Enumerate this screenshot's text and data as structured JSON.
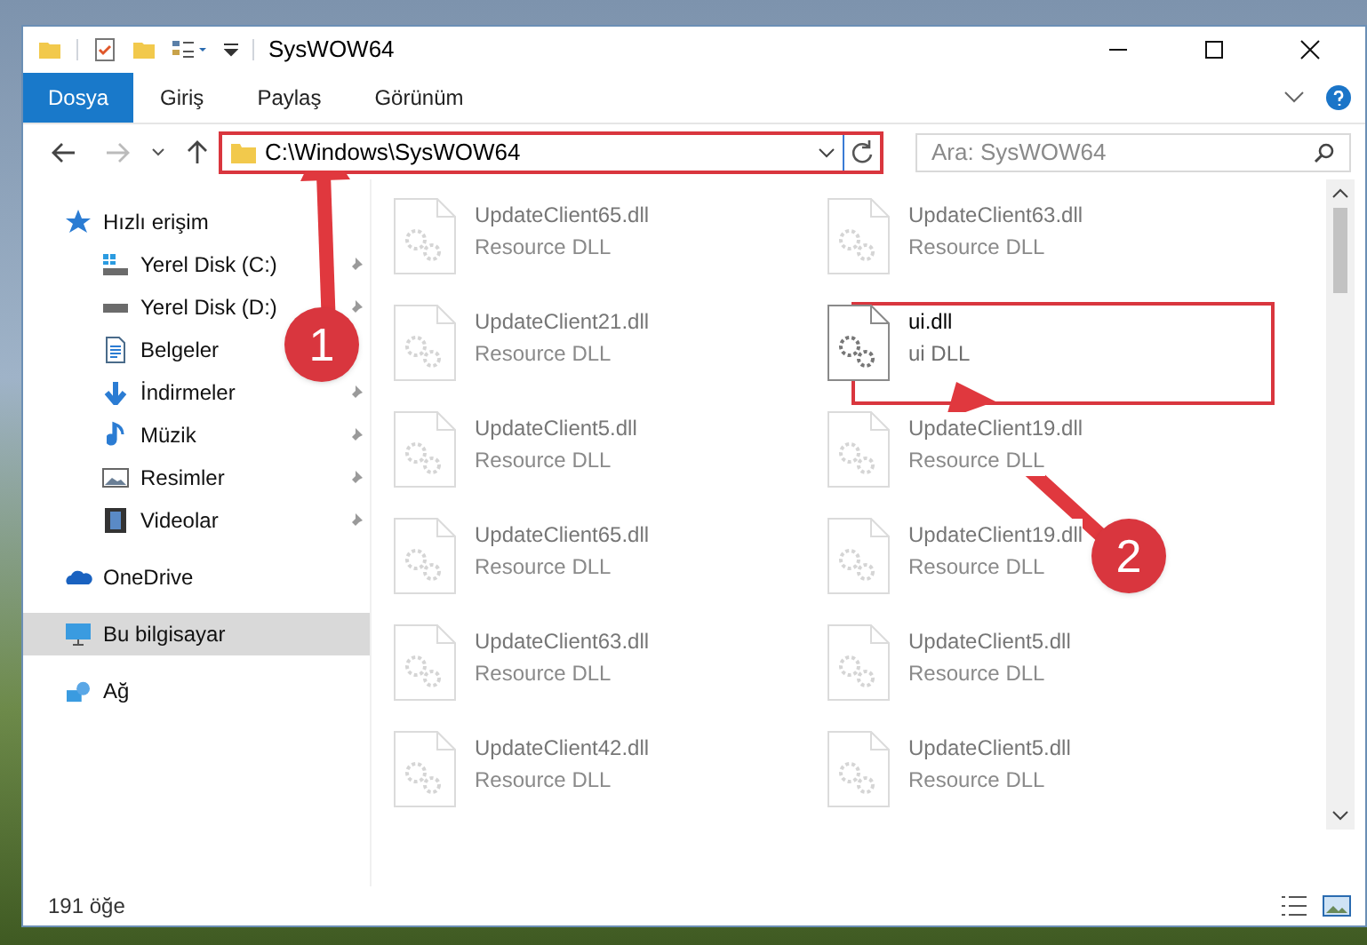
{
  "window": {
    "title": "SysWOW64"
  },
  "ribbon_tabs": [
    {
      "label": "Dosya",
      "selected": true
    },
    {
      "label": "Giriş",
      "selected": false
    },
    {
      "label": "Paylaş",
      "selected": false
    },
    {
      "label": "Görünüm",
      "selected": false
    }
  ],
  "address_bar": {
    "path": "C:\\Windows\\SysWOW64"
  },
  "search": {
    "placeholder": "Ara: SysWOW64"
  },
  "sidebar": {
    "items": [
      {
        "label": "Hızlı erişim",
        "selected": false,
        "children": [
          {
            "label": "Yerel Disk (C:)",
            "pinned": true,
            "selected": false
          },
          {
            "label": "Yerel Disk (D:)",
            "pinned": true,
            "selected": false
          },
          {
            "label": "Belgeler",
            "pinned": false,
            "selected": false
          },
          {
            "label": "İndirmeler",
            "pinned": true,
            "selected": false
          },
          {
            "label": "Müzik",
            "pinned": true,
            "selected": false
          },
          {
            "label": "Resimler",
            "pinned": true,
            "selected": false
          },
          {
            "label": "Videolar",
            "pinned": true,
            "selected": false
          }
        ]
      },
      {
        "label": "OneDrive",
        "selected": false
      },
      {
        "label": "Bu bilgisayar",
        "selected": true
      },
      {
        "label": "Ağ",
        "selected": false
      }
    ]
  },
  "files": [
    {
      "name": "UpdateClient65.dll",
      "type": "Resource DLL",
      "faded": true
    },
    {
      "name": "UpdateClient63.dll",
      "type": "Resource DLL",
      "faded": true
    },
    {
      "name": "UpdateClient21.dll",
      "type": "Resource DLL",
      "faded": true
    },
    {
      "name": "ui.dll",
      "type": "ui DLL",
      "faded": false
    },
    {
      "name": "UpdateClient5.dll",
      "type": "Resource DLL",
      "faded": true
    },
    {
      "name": "UpdateClient19.dll",
      "type": "Resource DLL",
      "faded": true
    },
    {
      "name": "UpdateClient65.dll",
      "type": "Resource DLL",
      "faded": true
    },
    {
      "name": "UpdateClient19.dll",
      "type": "Resource DLL",
      "faded": true
    },
    {
      "name": "UpdateClient63.dll",
      "type": "Resource DLL",
      "faded": true
    },
    {
      "name": "UpdateClient5.dll",
      "type": "Resource DLL",
      "faded": true
    },
    {
      "name": "UpdateClient42.dll",
      "type": "Resource DLL",
      "faded": true
    },
    {
      "name": "UpdateClient5.dll",
      "type": "Resource DLL",
      "faded": true
    }
  ],
  "status_bar": {
    "item_count": "191 öğe"
  },
  "callouts": [
    {
      "label": "1"
    },
    {
      "label": "2"
    }
  ]
}
